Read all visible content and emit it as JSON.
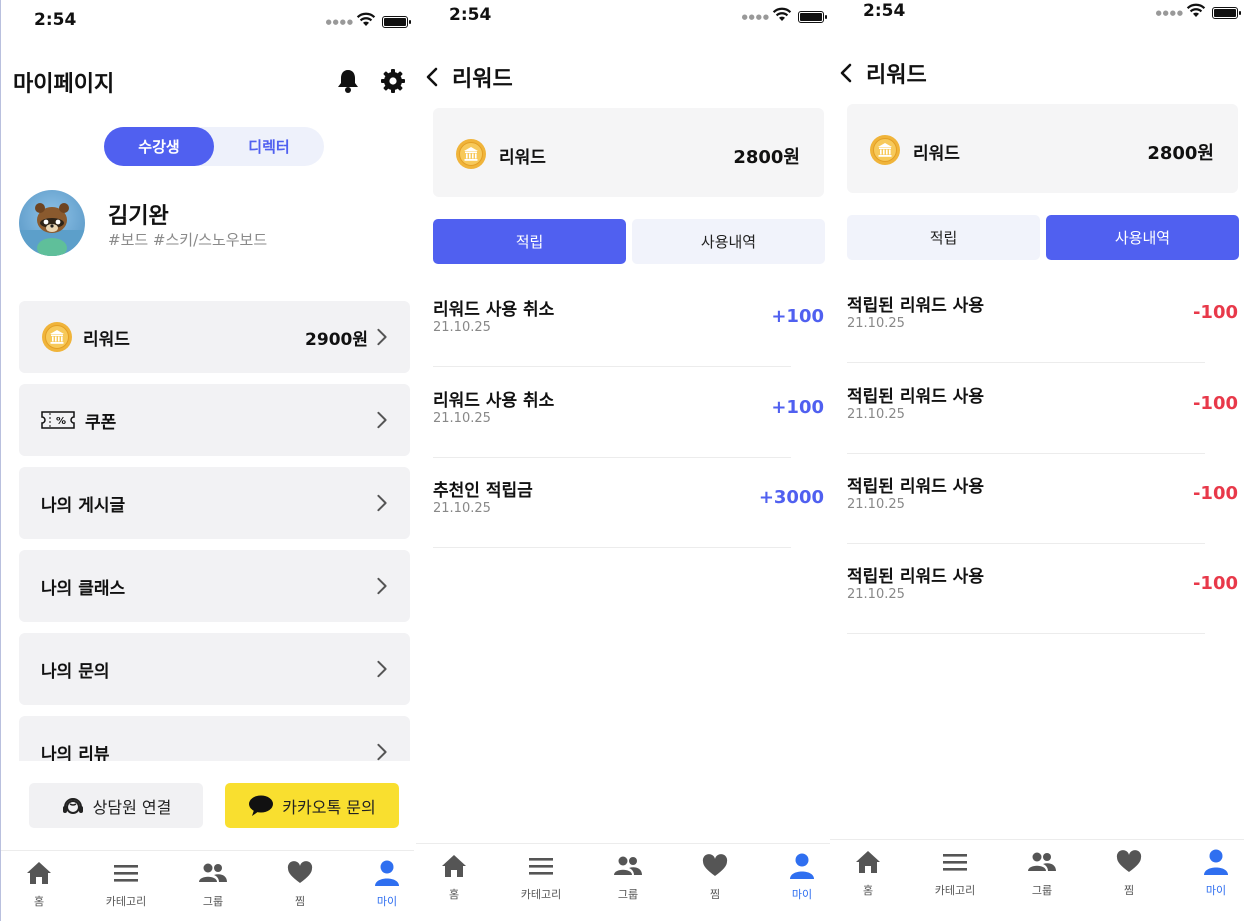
{
  "status": {
    "time": "2:54"
  },
  "mypage": {
    "title": "마이페이지",
    "toggle": {
      "student": "수강생",
      "director": "디렉터"
    },
    "profile": {
      "name": "김기완",
      "tags": "#보드 #스키/스노우보드"
    },
    "menu": {
      "reward_label": "리워드",
      "reward_amount": "2900원",
      "coupon_label": "쿠폰",
      "posts_label": "나의 게시글",
      "classes_label": "나의 클래스",
      "inquiries_label": "나의 문의",
      "reviews_label": "나의 리뷰"
    },
    "support": {
      "counsel": "상담원 연결",
      "kakao": "카카오톡 문의"
    }
  },
  "nav": {
    "home": "홈",
    "category": "카테고리",
    "group": "그룹",
    "likes": "찜",
    "my": "마이"
  },
  "reward_earn": {
    "title": "리워드",
    "card_label": "리워드",
    "card_amount": "2800원",
    "tab_earn": "적립",
    "tab_usage": "사용내역",
    "items": [
      {
        "title": "리워드 사용 취소",
        "date": "21.10.25",
        "value": "+100"
      },
      {
        "title": "리워드 사용 취소",
        "date": "21.10.25",
        "value": "+100"
      },
      {
        "title": "추천인 적립금",
        "date": "21.10.25",
        "value": "+3000"
      }
    ]
  },
  "reward_usage": {
    "title": "리워드",
    "card_label": "리워드",
    "card_amount": "2800원",
    "tab_earn": "적립",
    "tab_usage": "사용내역",
    "items": [
      {
        "title": "적립된 리워드 사용",
        "date": "21.10.25",
        "value": "-100"
      },
      {
        "title": "적립된 리워드 사용",
        "date": "21.10.25",
        "value": "-100"
      },
      {
        "title": "적립된 리워드 사용",
        "date": "21.10.25",
        "value": "-100"
      },
      {
        "title": "적립된 리워드 사용",
        "date": "21.10.25",
        "value": "-100"
      }
    ]
  },
  "colors": {
    "accent": "#5060f0",
    "negative": "#e8394a",
    "kakao": "#f9df2f",
    "nav_active": "#2f6ff0"
  },
  "icons": {
    "bell": "bell-icon",
    "gear": "gear-icon",
    "coin": "coin-icon",
    "coupon": "coupon-icon",
    "chevron": "chevron-right-icon",
    "back": "back-arrow-icon",
    "headset": "headset-icon",
    "chat": "chat-bubble-icon",
    "home": "home-icon",
    "menu": "menu-icon",
    "group": "group-icon",
    "heart": "heart-icon",
    "person": "person-icon"
  }
}
